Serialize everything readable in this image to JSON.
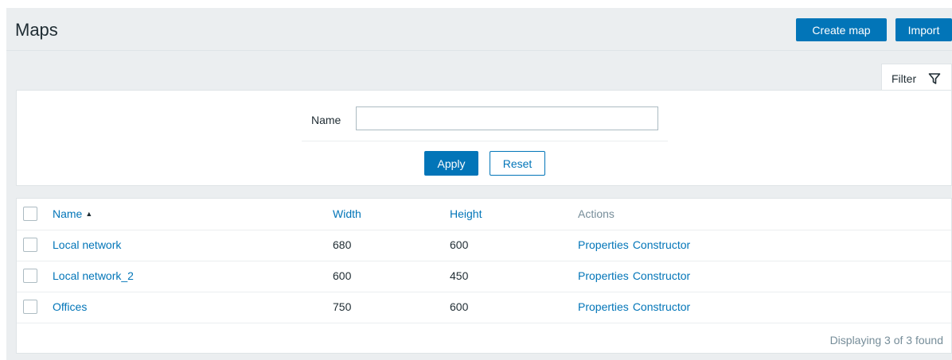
{
  "header": {
    "title": "Maps",
    "create_label": "Create map",
    "import_label": "Import"
  },
  "filter": {
    "tab_label": "Filter",
    "name_label": "Name",
    "name_value": "",
    "apply_label": "Apply",
    "reset_label": "Reset"
  },
  "table": {
    "columns": {
      "name": "Name",
      "width": "Width",
      "height": "Height",
      "actions": "Actions"
    },
    "sort_indicator": "▲",
    "rows": [
      {
        "name": "Local network",
        "width": "680",
        "height": "600",
        "properties": "Properties",
        "constructor": "Constructor"
      },
      {
        "name": "Local network_2",
        "width": "600",
        "height": "450",
        "properties": "Properties",
        "constructor": "Constructor"
      },
      {
        "name": "Offices",
        "width": "750",
        "height": "600",
        "properties": "Properties",
        "constructor": "Constructor"
      }
    ],
    "footer": "Displaying 3 of 3 found"
  },
  "colors": {
    "accent": "#0275b8",
    "background": "#ebeef0",
    "text": "#1f2c33",
    "muted": "#768d99"
  }
}
